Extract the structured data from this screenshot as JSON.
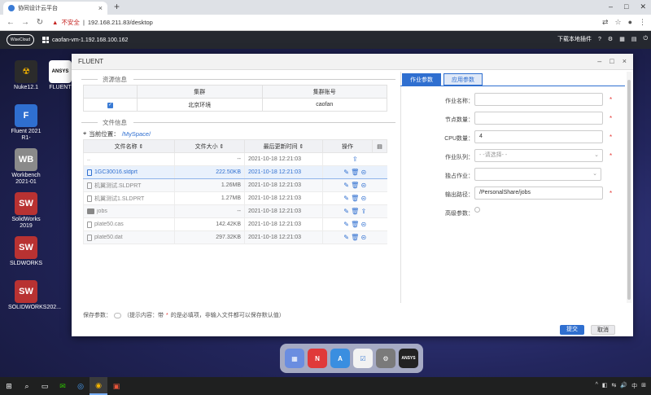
{
  "browser": {
    "tab_title": "协同设计云平台",
    "tab_close": "×",
    "new_tab": "+",
    "window_controls": [
      "–",
      "□",
      "✕"
    ],
    "security_label": "不安全",
    "url": "192.168.211.83/desktop"
  },
  "remote_bar": {
    "logo_text": "WiseCloud",
    "host": "caofan-vm-1.192.168.100.162",
    "download_label": "下载本地插件"
  },
  "desktop_icons": [
    {
      "label": "Nuke12.1",
      "color": "#2b2b2b",
      "glyph": "☢"
    },
    {
      "label": "FLUENT",
      "color": "#ffffff",
      "glyph": "ANSYS"
    },
    {
      "label": "Fluent 2021 R1-",
      "color": "#2f6fd0",
      "glyph": "F"
    },
    {
      "label": "Workbench 2021-01",
      "color": "#8a8a8a",
      "glyph": "WB"
    },
    {
      "label": "SolidWorks 2019",
      "color": "#b83232",
      "glyph": "SW"
    },
    {
      "label": "SLDWORKS",
      "color": "#b83232",
      "glyph": "SW"
    },
    {
      "label": "SOLIDWORKS202...",
      "color": "#b83232",
      "glyph": "SW"
    }
  ],
  "dialog": {
    "title": "FLUENT",
    "controls": [
      "–",
      "□",
      "×"
    ],
    "resource_section": "资源信息",
    "resource_headers": [
      "",
      "集群",
      "集群账号"
    ],
    "resource_rows": [
      [
        "✓",
        "北京环境",
        "caofan"
      ]
    ],
    "file_section": "文件信息",
    "location_label": "当前位置：",
    "location_path": "/MySpace/",
    "file_headers": [
      "文件名称 ⇕",
      "文件大小 ⇕",
      "最后更新时间 ⇕",
      "操作",
      "▤"
    ],
    "files": [
      {
        "name": "..",
        "size": "--",
        "time": "2021-10-18 12:21:03",
        "ops": "⇪",
        "type": "up"
      },
      {
        "name": "1GC30016.sldprt",
        "size": "222.50KB",
        "time": "2021-10-18 12:21:03",
        "ops": "✎ 🗑 ⊝",
        "type": "file"
      },
      {
        "name": "机翼测试.SLDPRT",
        "size": "1.26MB",
        "time": "2021-10-18 12:21:03",
        "ops": "✎ 🗑 ⊝",
        "type": "file"
      },
      {
        "name": "机翼测试1.SLDPRT",
        "size": "1.27MB",
        "time": "2021-10-18 12:21:03",
        "ops": "✎ 🗑 ⊝",
        "type": "file"
      },
      {
        "name": "jobs",
        "size": "--",
        "time": "2021-10-18 12:21:03",
        "ops": "✎ 🗑 ⇪",
        "type": "folder"
      },
      {
        "name": "plate50.cas",
        "size": "142.42KB",
        "time": "2021-10-18 12:21:03",
        "ops": "✎ 🗑 ⊝",
        "type": "file"
      },
      {
        "name": "plate50.dat",
        "size": "297.32KB",
        "time": "2021-10-18 12:21:03",
        "ops": "✎ 🗑 ⊝",
        "type": "file"
      }
    ],
    "tabs": [
      "作业参数",
      "应用参数"
    ],
    "form": {
      "job_name": {
        "label": "作业名称：",
        "value": "",
        "required": "*"
      },
      "node_count": {
        "label": "节点数量：",
        "value": "",
        "required": "*"
      },
      "cpu_count": {
        "label": "CPU数量：",
        "value": "4",
        "required": "*"
      },
      "queue": {
        "label": "作业队列：",
        "placeholder": "- -请选择- -",
        "required": "*"
      },
      "exclusive": {
        "label": "独占作业：",
        "value": ""
      },
      "output_path": {
        "label": "输出路径：",
        "value": "/PersonalShare/jobs",
        "required": "*"
      },
      "advanced": {
        "label": "高级参数："
      }
    },
    "save_params_label": "保存参数：",
    "save_hint_pre": "（提示内容：带",
    "save_hint_star": "*",
    "save_hint_post": "的是必填项，非输入文件都可以保存默认值）",
    "submit_label": "提交",
    "cancel_label": "取消"
  },
  "dock": [
    {
      "name": "launchpad",
      "color": "#6a8de0",
      "glyph": "▦"
    },
    {
      "name": "news",
      "color": "#e03a3a",
      "glyph": "N"
    },
    {
      "name": "app-store",
      "color": "#3a8ee0",
      "glyph": "A"
    },
    {
      "name": "reminders",
      "color": "#f2f2f2",
      "glyph": "☑"
    },
    {
      "name": "settings",
      "color": "#7a7a7a",
      "glyph": "⚙"
    },
    {
      "name": "ansys",
      "color": "#222222",
      "glyph": "ANSYS"
    }
  ],
  "taskbar": {
    "start": "⊞",
    "search": "⌕",
    "taskview": "▭",
    "wechat": "✉",
    "app": "◎",
    "chrome": "◉",
    "app2": "▣",
    "tray": [
      "^",
      "◧",
      "⇆",
      "🔊",
      "中",
      "⊞"
    ]
  }
}
